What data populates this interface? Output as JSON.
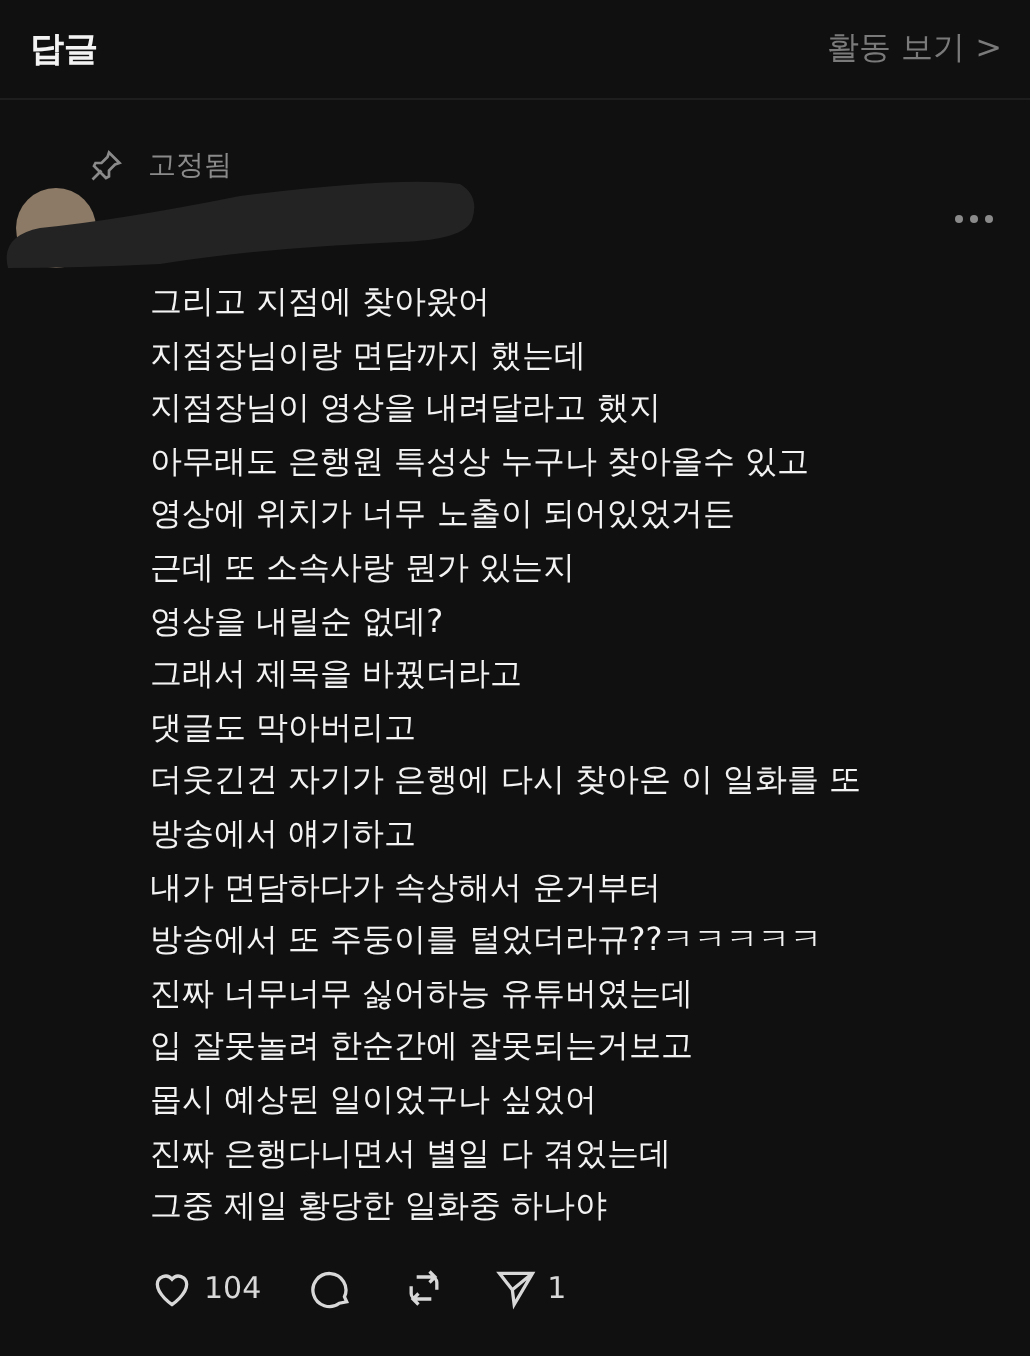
{
  "header": {
    "title": "답글",
    "activity_link": "활동 보기 >"
  },
  "post": {
    "pinned_label": "고정됨",
    "lines": [
      "그리고 지점에 찾아왔어",
      "지점장님이랑 면담까지 했는데",
      "지점장님이 영상을 내려달라고 했지",
      "아무래도 은행원 특성상 누구나 찾아올수 있고",
      "영상에 위치가 너무 노출이 되어있었거든",
      "근데 또 소속사랑 뭔가 있는지",
      "영상을 내릴순 없데?",
      "그래서 제목을 바꿨더라고",
      "댓글도 막아버리고",
      "더웃긴건 자기가 은행에 다시 찾아온 이 일화를 또",
      "방송에서 얘기하고",
      "내가 면담하다가 속상해서 운거부터",
      "방송에서 또 주둥이를 털었더라규??ㅋㅋㅋㅋㅋ",
      "진짜 너무너무 싫어하능 유튜버였는데",
      "입 잘못놀려 한순간에 잘못되는거보고",
      "몹시 예상된 일이었구나 싶었어",
      "진짜 은행다니면서 별일 다 겪었는데",
      "그중 제일 황당한 일화중 하나야"
    ],
    "actions": [
      {
        "kind": "like",
        "count": "104"
      },
      {
        "kind": "reply"
      },
      {
        "kind": "repost"
      },
      {
        "kind": "share",
        "count": "1"
      }
    ]
  }
}
